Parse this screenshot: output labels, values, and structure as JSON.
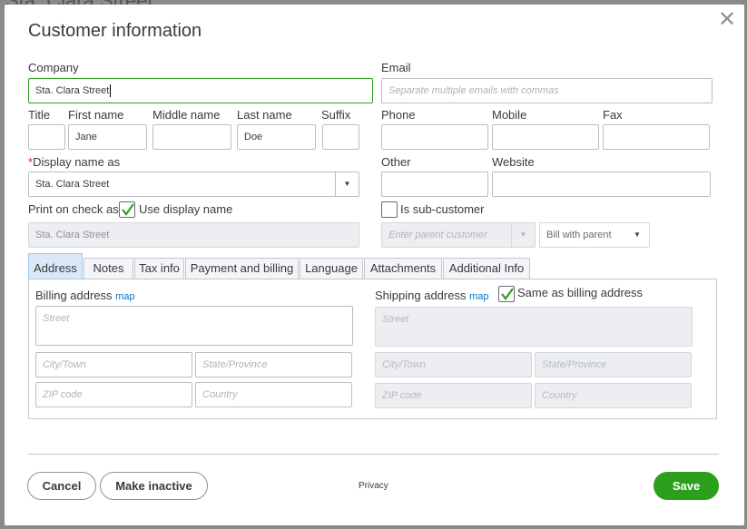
{
  "background": {
    "text": "Sta. Clara Street"
  },
  "dialog": {
    "title": "Customer information",
    "close_glyph": "✕"
  },
  "form": {
    "company": {
      "label": "Company",
      "value": "Sta. Clara Street"
    },
    "email": {
      "label": "Email",
      "placeholder": "Separate multiple emails with commas"
    },
    "title": {
      "label": "Title",
      "value": ""
    },
    "first_name": {
      "label": "First name",
      "value": "Jane"
    },
    "middle_name": {
      "label": "Middle name",
      "value": ""
    },
    "last_name": {
      "label": "Last name",
      "value": "Doe"
    },
    "suffix": {
      "label": "Suffix",
      "value": ""
    },
    "phone": {
      "label": "Phone",
      "value": ""
    },
    "mobile": {
      "label": "Mobile",
      "value": ""
    },
    "fax": {
      "label": "Fax",
      "value": ""
    },
    "display_name": {
      "required_mark": "*",
      "label": "Display name as",
      "value": "Sta. Clara Street"
    },
    "other": {
      "label": "Other",
      "value": ""
    },
    "website": {
      "label": "Website",
      "value": ""
    },
    "print_on_check": {
      "label": "Print on check as",
      "use_display_label": "Use display name",
      "use_display_checked": true,
      "value": "Sta. Clara Street"
    },
    "sub_customer": {
      "label": "Is sub-customer",
      "checked": false,
      "parent_placeholder": "Enter parent customer",
      "bill_option": "Bill with parent"
    }
  },
  "tabs": [
    {
      "label": "Address",
      "active": true
    },
    {
      "label": "Notes"
    },
    {
      "label": "Tax info"
    },
    {
      "label": "Payment and billing"
    },
    {
      "label": "Language"
    },
    {
      "label": "Attachments"
    },
    {
      "label": "Additional Info"
    }
  ],
  "address": {
    "billing": {
      "title": "Billing address",
      "map": "map",
      "street": "Street",
      "city": "City/Town",
      "state": "State/Province",
      "zip": "ZIP code",
      "country": "Country"
    },
    "shipping": {
      "title": "Shipping address",
      "map": "map",
      "same_label": "Same as billing address",
      "same_checked": true,
      "street": "Street",
      "city": "City/Town",
      "state": "State/Province",
      "zip": "ZIP code",
      "country": "Country"
    }
  },
  "footer": {
    "cancel": "Cancel",
    "make_inactive": "Make inactive",
    "privacy": "Privacy",
    "save": "Save"
  },
  "colors": {
    "accent": "#2ca01c",
    "link": "#0077c5",
    "required": "#d52b1e"
  },
  "icons": {
    "close": "close-icon",
    "dropdown": "caret-down-icon",
    "check": "checkmark-icon"
  }
}
